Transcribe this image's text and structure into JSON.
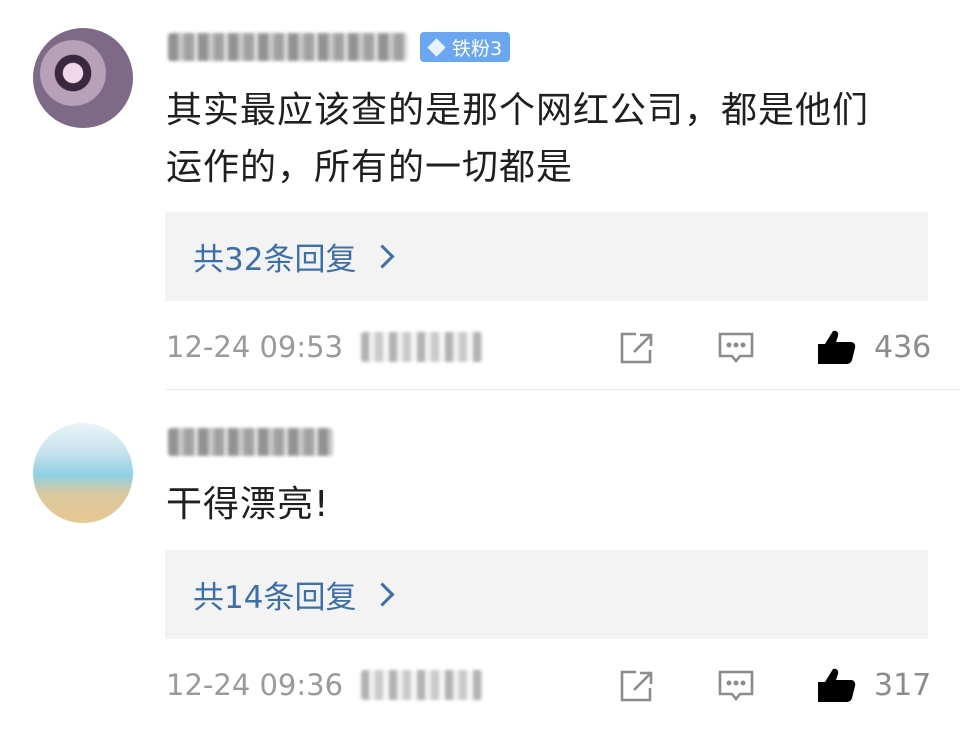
{
  "comments": [
    {
      "badge": "铁粉3",
      "text_line1": "其实最应该查的是那个网红公司，都是他们",
      "text_line2": "运作的，所有的一切都是",
      "replies": "共32条回复",
      "time": "12-24 09:53",
      "likes": "436"
    },
    {
      "text_line1": "干得漂亮!",
      "replies": "共14条回复",
      "time": "12-24 09:36",
      "likes": "317"
    }
  ],
  "icons": {
    "share": "share-icon",
    "comment": "comment-icon",
    "like": "thumbs-up-icon",
    "chevron": "chevron-right-icon",
    "badge": "diamond-icon"
  },
  "colors": {
    "link": "#3f6fa8",
    "badge_bg": "#6aa7f0",
    "reply_bg": "#f3f3f3",
    "meta": "#9a9a9a"
  }
}
